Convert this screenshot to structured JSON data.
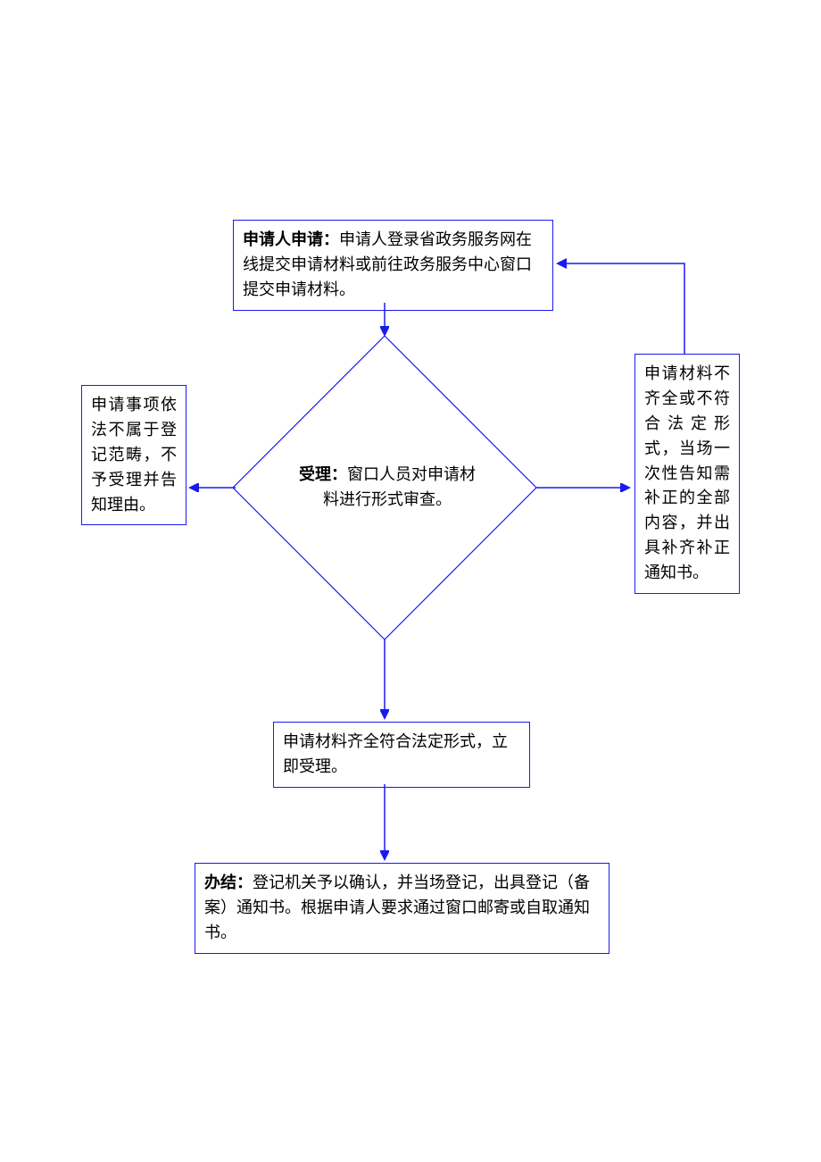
{
  "colors": {
    "border": "#1a1af0",
    "arrow": "#1a1af0"
  },
  "boxes": {
    "apply": {
      "title_label": "申请人申请：",
      "body": "申请人登录省政务服务网在线提交申请材料或前往政务服务中心窗口提交申请材料。"
    },
    "accept": {
      "title_label": "受理：",
      "body": "窗口人员对申请材料进行形式审查。"
    },
    "reject": {
      "body": "申请事项依法不属于登记范畴，不予受理并告知理由。"
    },
    "supplement": {
      "body": "申请材料不齐全或不符合法定形式，当场一次性告知需补正的全部内容，并出具补齐补正通知书。"
    },
    "materials_ok": {
      "body": "申请材料齐全符合法定形式，立即受理。"
    },
    "finish": {
      "title_label": "办结：",
      "body": "登记机关予以确认，并当场登记，出具登记（备案）通知书。根据申请人要求通过窗口邮寄或自取通知书。"
    }
  }
}
